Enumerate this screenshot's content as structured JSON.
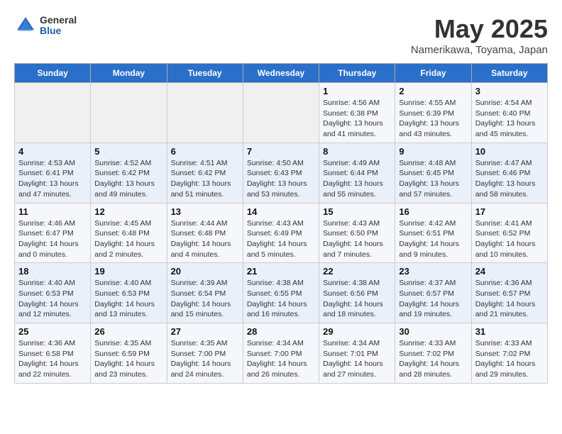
{
  "header": {
    "logo_general": "General",
    "logo_blue": "Blue",
    "title": "May 2025",
    "subtitle": "Namerikawa, Toyama, Japan"
  },
  "weekdays": [
    "Sunday",
    "Monday",
    "Tuesday",
    "Wednesday",
    "Thursday",
    "Friday",
    "Saturday"
  ],
  "weeks": [
    [
      {
        "day": "",
        "info": ""
      },
      {
        "day": "",
        "info": ""
      },
      {
        "day": "",
        "info": ""
      },
      {
        "day": "",
        "info": ""
      },
      {
        "day": "1",
        "info": "Sunrise: 4:56 AM\nSunset: 6:38 PM\nDaylight: 13 hours\nand 41 minutes."
      },
      {
        "day": "2",
        "info": "Sunrise: 4:55 AM\nSunset: 6:39 PM\nDaylight: 13 hours\nand 43 minutes."
      },
      {
        "day": "3",
        "info": "Sunrise: 4:54 AM\nSunset: 6:40 PM\nDaylight: 13 hours\nand 45 minutes."
      }
    ],
    [
      {
        "day": "4",
        "info": "Sunrise: 4:53 AM\nSunset: 6:41 PM\nDaylight: 13 hours\nand 47 minutes."
      },
      {
        "day": "5",
        "info": "Sunrise: 4:52 AM\nSunset: 6:42 PM\nDaylight: 13 hours\nand 49 minutes."
      },
      {
        "day": "6",
        "info": "Sunrise: 4:51 AM\nSunset: 6:42 PM\nDaylight: 13 hours\nand 51 minutes."
      },
      {
        "day": "7",
        "info": "Sunrise: 4:50 AM\nSunset: 6:43 PM\nDaylight: 13 hours\nand 53 minutes."
      },
      {
        "day": "8",
        "info": "Sunrise: 4:49 AM\nSunset: 6:44 PM\nDaylight: 13 hours\nand 55 minutes."
      },
      {
        "day": "9",
        "info": "Sunrise: 4:48 AM\nSunset: 6:45 PM\nDaylight: 13 hours\nand 57 minutes."
      },
      {
        "day": "10",
        "info": "Sunrise: 4:47 AM\nSunset: 6:46 PM\nDaylight: 13 hours\nand 58 minutes."
      }
    ],
    [
      {
        "day": "11",
        "info": "Sunrise: 4:46 AM\nSunset: 6:47 PM\nDaylight: 14 hours\nand 0 minutes."
      },
      {
        "day": "12",
        "info": "Sunrise: 4:45 AM\nSunset: 6:48 PM\nDaylight: 14 hours\nand 2 minutes."
      },
      {
        "day": "13",
        "info": "Sunrise: 4:44 AM\nSunset: 6:48 PM\nDaylight: 14 hours\nand 4 minutes."
      },
      {
        "day": "14",
        "info": "Sunrise: 4:43 AM\nSunset: 6:49 PM\nDaylight: 14 hours\nand 5 minutes."
      },
      {
        "day": "15",
        "info": "Sunrise: 4:43 AM\nSunset: 6:50 PM\nDaylight: 14 hours\nand 7 minutes."
      },
      {
        "day": "16",
        "info": "Sunrise: 4:42 AM\nSunset: 6:51 PM\nDaylight: 14 hours\nand 9 minutes."
      },
      {
        "day": "17",
        "info": "Sunrise: 4:41 AM\nSunset: 6:52 PM\nDaylight: 14 hours\nand 10 minutes."
      }
    ],
    [
      {
        "day": "18",
        "info": "Sunrise: 4:40 AM\nSunset: 6:53 PM\nDaylight: 14 hours\nand 12 minutes."
      },
      {
        "day": "19",
        "info": "Sunrise: 4:40 AM\nSunset: 6:53 PM\nDaylight: 14 hours\nand 13 minutes."
      },
      {
        "day": "20",
        "info": "Sunrise: 4:39 AM\nSunset: 6:54 PM\nDaylight: 14 hours\nand 15 minutes."
      },
      {
        "day": "21",
        "info": "Sunrise: 4:38 AM\nSunset: 6:55 PM\nDaylight: 14 hours\nand 16 minutes."
      },
      {
        "day": "22",
        "info": "Sunrise: 4:38 AM\nSunset: 6:56 PM\nDaylight: 14 hours\nand 18 minutes."
      },
      {
        "day": "23",
        "info": "Sunrise: 4:37 AM\nSunset: 6:57 PM\nDaylight: 14 hours\nand 19 minutes."
      },
      {
        "day": "24",
        "info": "Sunrise: 4:36 AM\nSunset: 6:57 PM\nDaylight: 14 hours\nand 21 minutes."
      }
    ],
    [
      {
        "day": "25",
        "info": "Sunrise: 4:36 AM\nSunset: 6:58 PM\nDaylight: 14 hours\nand 22 minutes."
      },
      {
        "day": "26",
        "info": "Sunrise: 4:35 AM\nSunset: 6:59 PM\nDaylight: 14 hours\nand 23 minutes."
      },
      {
        "day": "27",
        "info": "Sunrise: 4:35 AM\nSunset: 7:00 PM\nDaylight: 14 hours\nand 24 minutes."
      },
      {
        "day": "28",
        "info": "Sunrise: 4:34 AM\nSunset: 7:00 PM\nDaylight: 14 hours\nand 26 minutes."
      },
      {
        "day": "29",
        "info": "Sunrise: 4:34 AM\nSunset: 7:01 PM\nDaylight: 14 hours\nand 27 minutes."
      },
      {
        "day": "30",
        "info": "Sunrise: 4:33 AM\nSunset: 7:02 PM\nDaylight: 14 hours\nand 28 minutes."
      },
      {
        "day": "31",
        "info": "Sunrise: 4:33 AM\nSunset: 7:02 PM\nDaylight: 14 hours\nand 29 minutes."
      }
    ]
  ]
}
